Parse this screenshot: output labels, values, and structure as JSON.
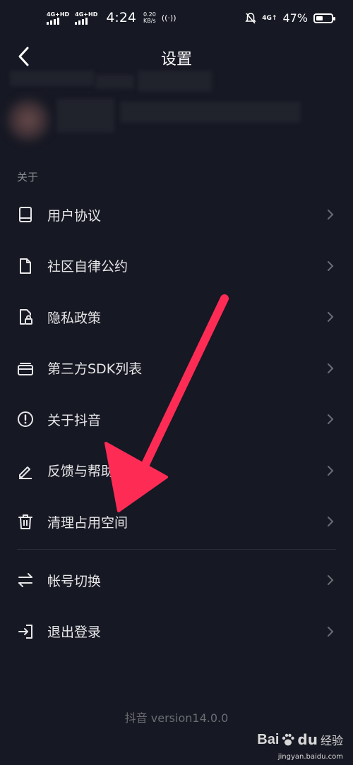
{
  "status_bar": {
    "sim1": "4G+HD",
    "sim2": "4G+HD",
    "time": "4:24",
    "speed_value": "0.20",
    "speed_unit": "KB/s",
    "net_type": "4G↑",
    "battery": "47%",
    "battery_level": 0.47
  },
  "header": {
    "title": "设置",
    "back_icon": "chevron-left-icon"
  },
  "section": {
    "label": "关于"
  },
  "menu": [
    {
      "label": "用户协议",
      "icon": "book-icon"
    },
    {
      "label": "社区自律公约",
      "icon": "document-icon"
    },
    {
      "label": "隐私政策",
      "icon": "privacy-lock-icon"
    },
    {
      "label": "第三方SDK列表",
      "icon": "card-stack-icon"
    },
    {
      "label": "关于抖音",
      "icon": "info-circle-icon"
    },
    {
      "label": "反馈与帮助",
      "icon": "edit-pen-icon"
    },
    {
      "label": "清理占用空间",
      "icon": "trash-icon"
    }
  ],
  "account_menu": [
    {
      "label": "帐号切换",
      "icon": "switch-arrows-icon"
    },
    {
      "label": "退出登录",
      "icon": "logout-icon"
    }
  ],
  "version": "抖音 version14.0.0",
  "watermark": {
    "brand_a": "Bai",
    "brand_b": "du",
    "brand_cn": "经验",
    "url": "jingyan.baidu.com"
  },
  "colors": {
    "background": "#161823",
    "annotation_arrow": "#fe2c55",
    "text": "#e6e6e8",
    "muted": "#8a8b91"
  }
}
